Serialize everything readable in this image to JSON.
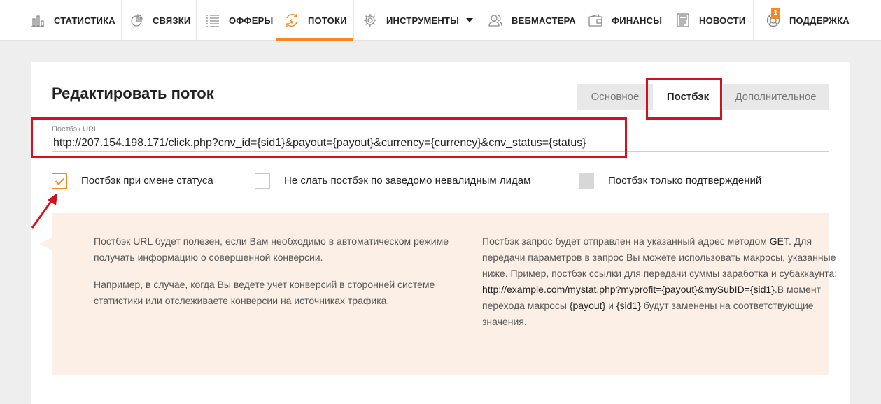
{
  "nav": {
    "items": [
      {
        "label": "СТАТИСТИКА",
        "icon": "bar-chart-icon"
      },
      {
        "label": "СВЯЗКИ",
        "icon": "pie-chart-icon"
      },
      {
        "label": "ОФФЕРЫ",
        "icon": "list-icon"
      },
      {
        "label": "ПОТОКИ",
        "icon": "money-cycle-icon",
        "active": true
      },
      {
        "label": "ИНСТРУМЕНТЫ",
        "icon": "gear-icon"
      },
      {
        "label": "ВЕБМАСТЕРА",
        "icon": "users-icon"
      },
      {
        "label": "ФИНАНСЫ",
        "icon": "wallet-icon"
      },
      {
        "label": "НОВОСТИ",
        "icon": "newspaper-icon"
      },
      {
        "label": "ПОДДЕРЖКА",
        "icon": "lifebuoy-icon",
        "badge": "1"
      }
    ],
    "accent_color": "#f5891f"
  },
  "page": {
    "title": "Редактировать поток"
  },
  "tabs": [
    {
      "label": "Основное"
    },
    {
      "label": "Постбэк",
      "active": true
    },
    {
      "label": "Дополнительное"
    }
  ],
  "postback": {
    "label": "Постбэк URL",
    "value": "http://207.154.198.171/click.php?cnv_id={sid1}&payout={payout}&currency={currency}&cnv_status={status}"
  },
  "checkboxes": [
    {
      "label": "Постбэк при смене статуса",
      "checked": true
    },
    {
      "label": "Не слать постбэк по заведомо невалидным лидам",
      "checked": false
    },
    {
      "label": "Постбэк только подтверждений",
      "disabled": true
    }
  ],
  "info": {
    "left": [
      "Постбэк URL будет полезен, если Вам необходимо в автоматическом режиме получать информацию о совершенной конверсии.",
      "Например, в случае, когда Вы ведете учет конверсий в сторонней системе статистики или отслеживаете конверсии на источниках трафика."
    ],
    "right": {
      "t1": "Постбэк запрос будет отправлен на указанный адрес методом",
      "get": "GET",
      "t2": ". Для передачи параметров в запрос Вы можете использовать макросы, указанные ниже. Пример, постбэк ссылки для передачи суммы заработка и субаккаунта: ",
      "example": "http://example.com/mystat.php?myprofit={payout}&mySubID={sid1}",
      "t3": ".В момент перехода макросы ",
      "m1": "{payout}",
      "t4": " и ",
      "m2": "{sid1}",
      "t5": " будут заменены на соответствующие значения."
    }
  },
  "highlight_color": "#d6101e"
}
